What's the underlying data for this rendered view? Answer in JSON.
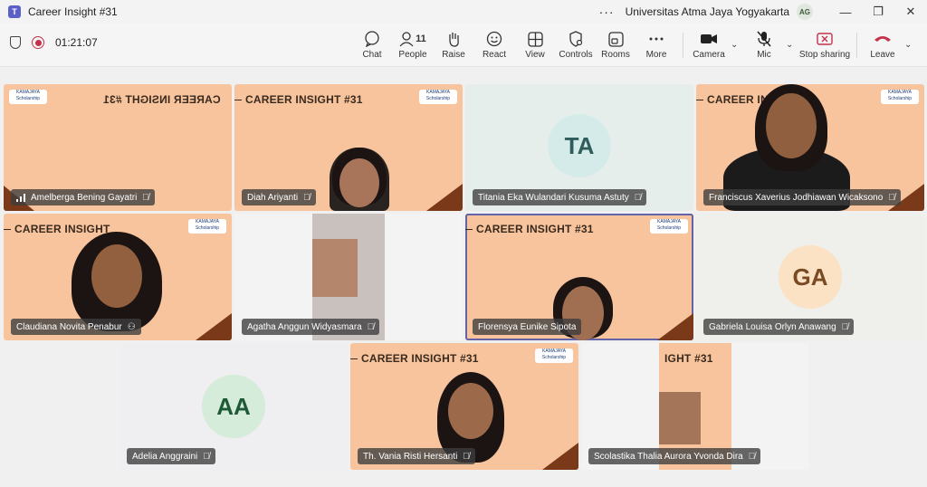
{
  "window": {
    "app_icon": "teams-icon",
    "title": "Career Insight #31",
    "more_label": "···",
    "org": "Universitas Atma Jaya Yogyakarta",
    "avatar_initials": "AG",
    "min_label": "—",
    "max_label": "❐",
    "close_label": "✕"
  },
  "toolbar": {
    "timer": "01:21:07",
    "people_count": "11",
    "buttons": {
      "chat": "Chat",
      "people": "People",
      "raise": "Raise",
      "react": "React",
      "view": "View",
      "controls": "Controls",
      "rooms": "Rooms",
      "more": "More",
      "camera": "Camera",
      "mic": "Mic",
      "stop_sharing": "Stop sharing",
      "leave": "Leave"
    },
    "accent": "#c4314b"
  },
  "banner_text": "CAREER INSIGHT #31",
  "banner_text_cut": "CAREER INSIGHT",
  "banner_text_tail": "IGHT #31",
  "brand_text": "KAMAJAYA Scholarship",
  "participants": [
    {
      "name": "Amelberga Bening Gayatri"
    },
    {
      "name": "Diah Ariyanti"
    },
    {
      "name": "Titania Eka Wulandari Kusuma Astuty",
      "initials": "TA"
    },
    {
      "name": "Franciscus Xaverius Jodhiawan Wicaksono"
    },
    {
      "name": "Claudiana Novita Penabur"
    },
    {
      "name": "Agatha Anggun Widyasmara"
    },
    {
      "name": "Florensya Eunike Sipota"
    },
    {
      "name": "Gabriela Louisa Orlyn Anawang",
      "initials": "GA"
    },
    {
      "name": "Adelia Anggraini",
      "initials": "AA"
    },
    {
      "name": "Th. Vania Risti Hersanti"
    },
    {
      "name": "Scolastika Thalia Aurora Yvonda Dira"
    }
  ],
  "colors": {
    "banner_bg": "#f7c49d",
    "accent_brown": "#7a3a1a",
    "active_outline": "#6264a7"
  }
}
